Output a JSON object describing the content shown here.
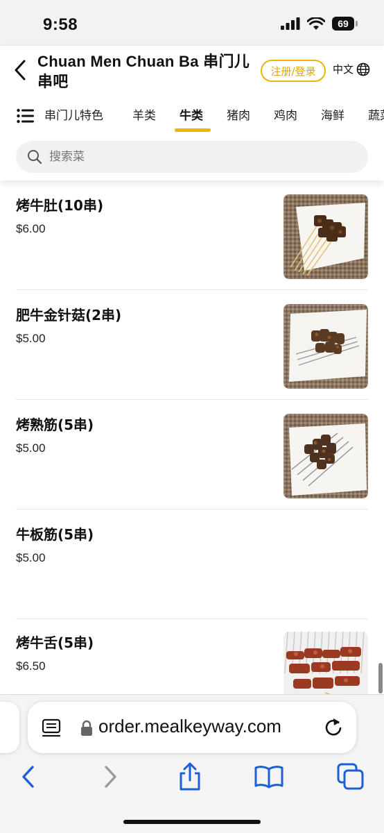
{
  "status_bar": {
    "time": "9:58",
    "battery": "69"
  },
  "header": {
    "title": "Chuan Men Chuan Ba 串门儿串吧",
    "login_label": "注册/登录",
    "lang_label": "中文"
  },
  "categories": [
    {
      "label": "串门儿特色",
      "active": false
    },
    {
      "label": "羊类",
      "active": false
    },
    {
      "label": "牛类",
      "active": true
    },
    {
      "label": "猪肉",
      "active": false
    },
    {
      "label": "鸡肉",
      "active": false
    },
    {
      "label": "海鲜",
      "active": false
    },
    {
      "label": "蔬菜",
      "active": false
    }
  ],
  "search": {
    "placeholder": "搜索菜"
  },
  "items": [
    {
      "name": "烤牛肚(10串)",
      "price": "$6.00",
      "has_image": true
    },
    {
      "name": "肥牛金针菇(2串)",
      "price": "$5.00",
      "has_image": true
    },
    {
      "name": "烤熟筋(5串)",
      "price": "$5.00",
      "has_image": true
    },
    {
      "name": "牛板筋(5串)",
      "price": "$5.00",
      "has_image": false
    },
    {
      "name": "烤牛舌(5串)",
      "price": "$6.50",
      "has_image": true
    }
  ],
  "browser": {
    "url": "order.mealkeyway.com"
  },
  "colors": {
    "accent": "#f3b400",
    "browser_blue": "#1a5fd8"
  }
}
